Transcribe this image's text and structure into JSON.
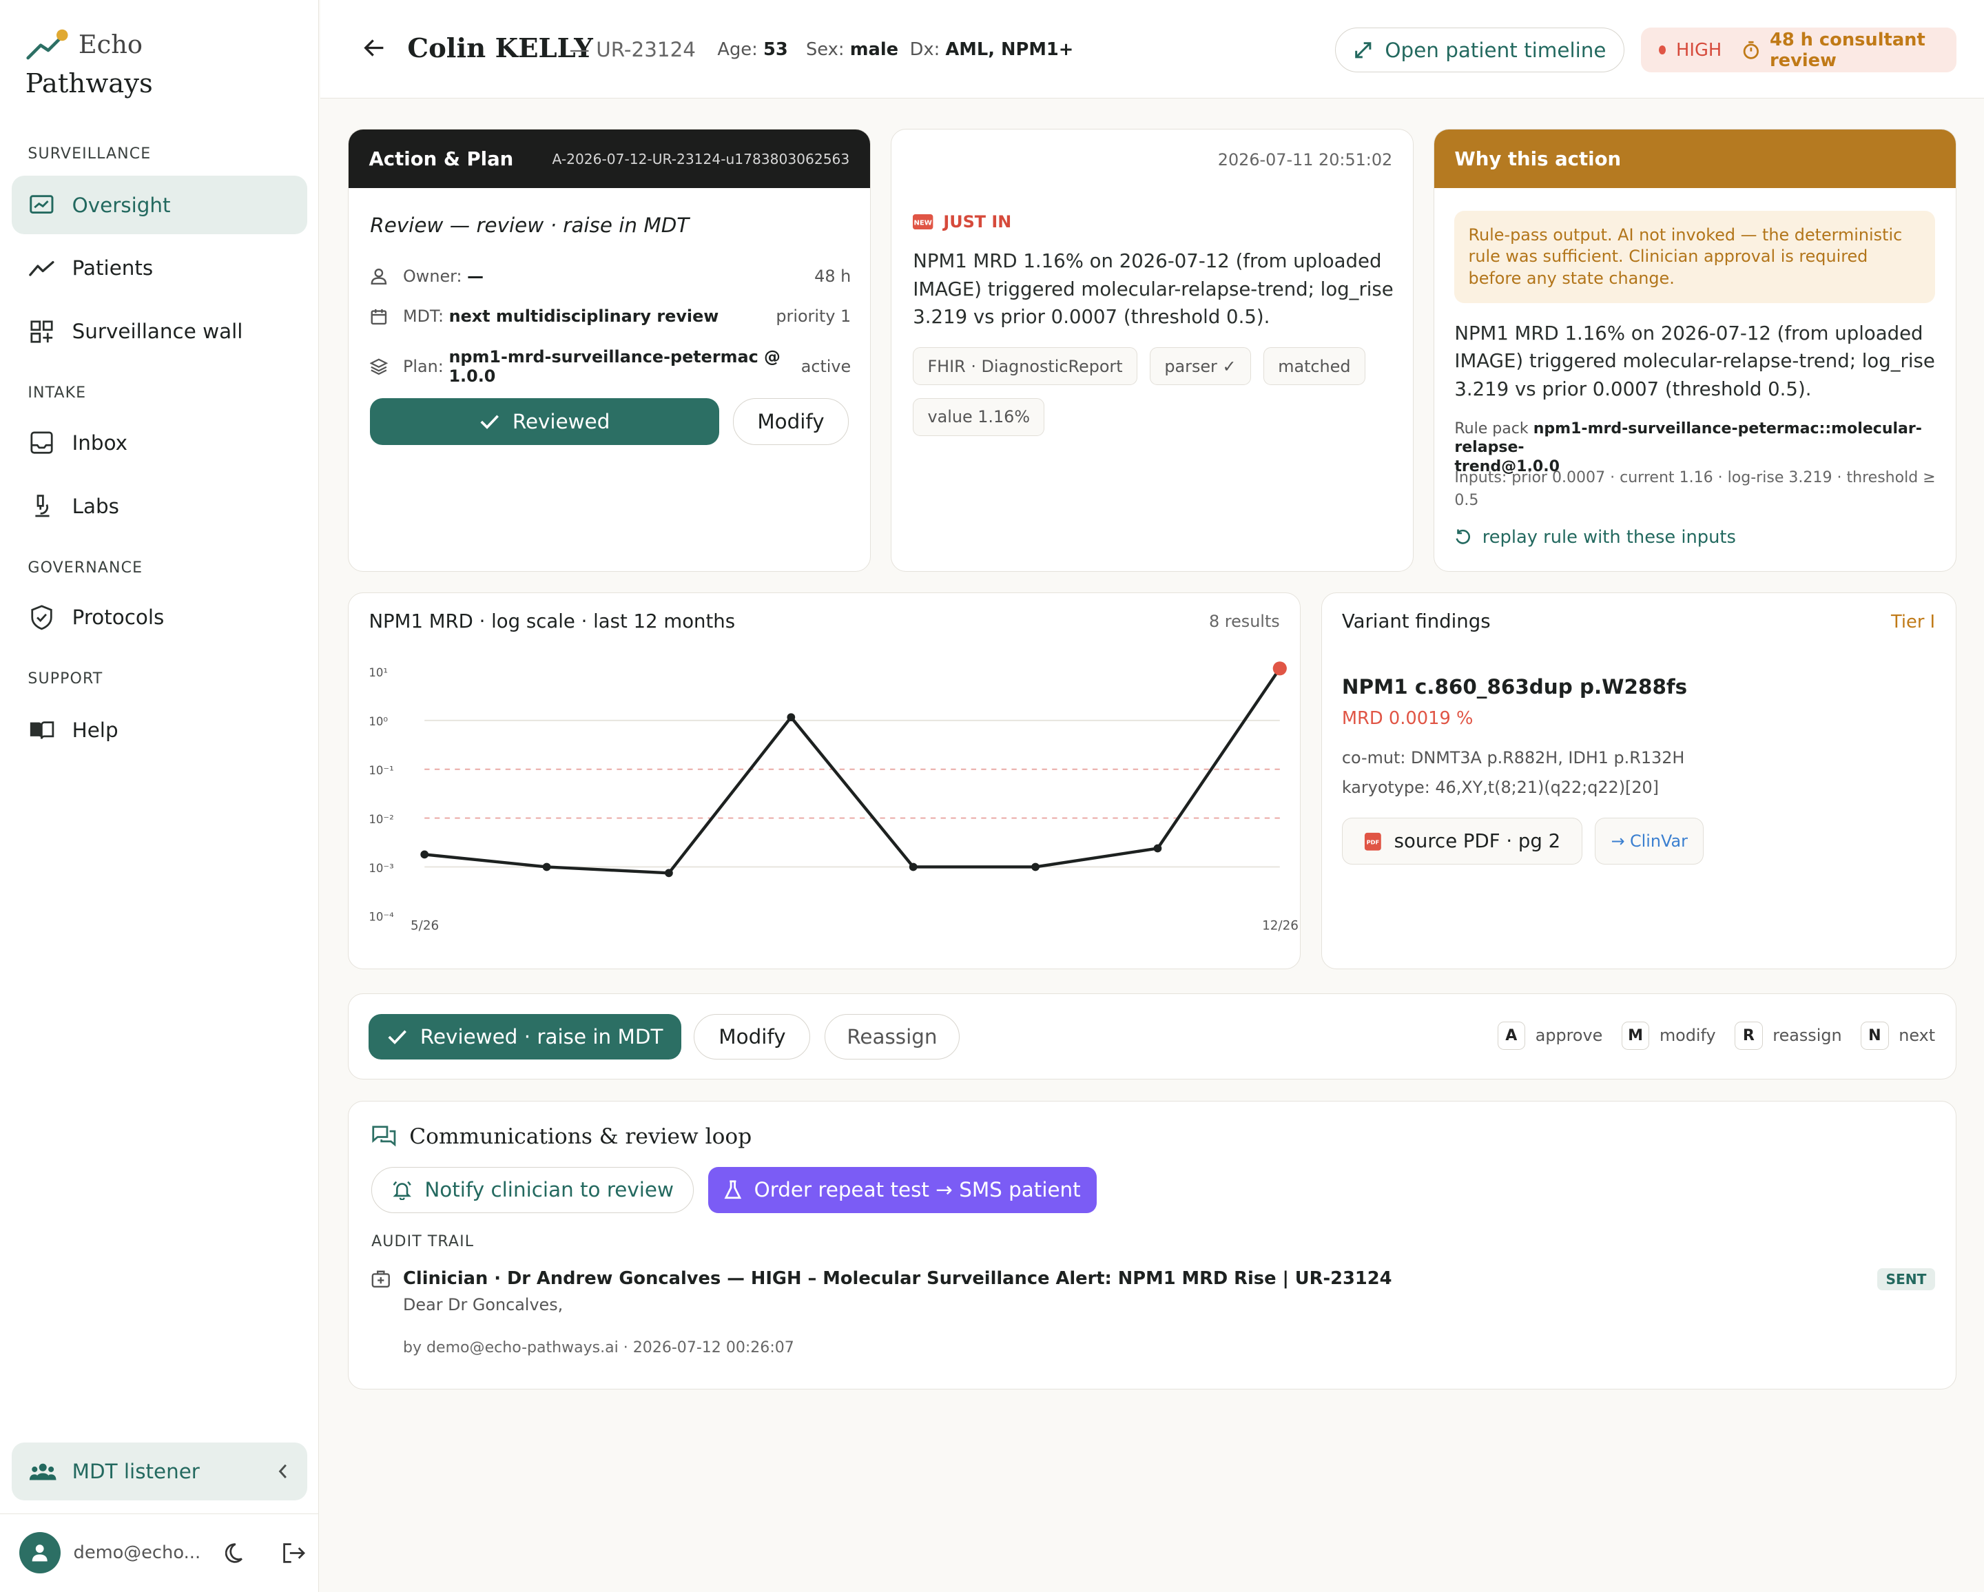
{
  "brand": {
    "name_top": "Echo",
    "name_bottom": "Pathways"
  },
  "sidebar": {
    "sections": [
      {
        "label": "SURVEILLANCE",
        "items": [
          {
            "label": "Oversight",
            "icon": "monitor-chart-icon",
            "active": true
          },
          {
            "label": "Patients",
            "icon": "trend-line-icon"
          },
          {
            "label": "Surveillance wall",
            "icon": "grid-plus-icon"
          }
        ]
      },
      {
        "label": "INTAKE",
        "items": [
          {
            "label": "Inbox",
            "icon": "inbox-icon"
          },
          {
            "label": "Labs",
            "icon": "microscope-icon"
          }
        ]
      },
      {
        "label": "GOVERNANCE",
        "items": [
          {
            "label": "Protocols",
            "icon": "shield-check-icon"
          }
        ]
      },
      {
        "label": "SUPPORT",
        "items": [
          {
            "label": "Help",
            "icon": "book-icon"
          }
        ]
      }
    ],
    "mdt_listener": "MDT listener",
    "user_email": "demo@echo..."
  },
  "header": {
    "name": "Colin KELLY",
    "ur": "— UR-23124",
    "age_label": "Age:",
    "age": "53",
    "sex_label": "Sex:",
    "sex": "male",
    "dx_label": "Dx:",
    "dx": "AML, NPM1+",
    "timeline_button": "Open patient timeline",
    "severity": "HIGH",
    "review_window": "48 h consultant review"
  },
  "action_plan": {
    "title": "Action & Plan",
    "id": "A-2026-07-12-UR-23124-u1783803062563",
    "subtitle": "Review — review · raise in MDT",
    "owner_label": "Owner:",
    "owner": "—",
    "owner_sla": "48 h",
    "mdt_label": "MDT:",
    "mdt": "next multidisciplinary review",
    "priority": "priority 1",
    "plan_label": "Plan:",
    "plan": "npm1-mrd-surveillance-petermac @ 1.0.0",
    "plan_status": "active",
    "reviewed_button": "Reviewed",
    "modify_button": "Modify"
  },
  "event": {
    "timestamp": "2026-07-11 20:51:02",
    "badge": "JUST IN",
    "text": "NPM1 MRD 1.16% on 2026-07-12 (from uploaded IMAGE) triggered molecular-relapse-trend; log_rise 3.219 vs prior 0.0007 (threshold 0.5).",
    "tags": [
      "FHIR · DiagnosticReport",
      "parser ✓",
      "matched",
      "value 1.16%"
    ]
  },
  "why": {
    "title": "Why this action",
    "note": "Rule-pass output. AI not invoked — the deterministic rule was sufficient. Clinician approval is required before any state change.",
    "text": "NPM1 MRD 1.16% on 2026-07-12 (from uploaded IMAGE) triggered molecular-relapse-trend; log_rise 3.219 vs prior 0.0007 (threshold 0.5).",
    "rule_pack_label": "Rule pack",
    "rule_pack_line1": "npm1-mrd-surveillance-petermac::molecular-relapse-",
    "rule_pack_line2": "trend@1.0.0",
    "inputs_line1": "Inputs: prior 0.0007 · current 1.16 · log-rise 3.219 · threshold ≥",
    "inputs_line2": "0.5",
    "replay": "replay rule with these inputs"
  },
  "chart_data": {
    "type": "line",
    "title": "NPM1 MRD · log scale · last 12 months",
    "results_count": "8 results",
    "x": [
      "5/26",
      "",
      "",
      "",
      "",
      "",
      "",
      "12/26"
    ],
    "x_tick_labels": [
      "5/26",
      "12/26"
    ],
    "y_ticks": [
      "10¹",
      "10⁰",
      "10⁻¹",
      "10⁻²",
      "10⁻³",
      "10⁻⁴"
    ],
    "y_tick_exponents": [
      1,
      0,
      -1,
      -2,
      -3,
      -4
    ],
    "ylim": [
      0.0001,
      10
    ],
    "log_scale": true,
    "series": [
      {
        "values": [
          0.0018,
          0.001,
          0.00075,
          1.16,
          0.001,
          0.001,
          0.0024,
          11.6
        ]
      }
    ],
    "threshold_lines": [
      0.1,
      0.01
    ],
    "last_point_highlight": true,
    "colors": {
      "line": "#1d2120",
      "last_point": "#e05545",
      "threshold": "#e8a4a0",
      "grid": "#e6e3dc"
    }
  },
  "variant": {
    "title": "Variant findings",
    "tier": "Tier I",
    "name": "NPM1 c.860_863dup p.W288fs",
    "mrd": "MRD 0.0019 %",
    "comut": "co-mut: DNMT3A p.R882H, IDH1 p.R132H",
    "karyotype": "karyotype: 46,XY,t(8;21)(q22;q22)[20]",
    "source_button": "source PDF · pg 2",
    "clinvar_button": "→ ClinVar"
  },
  "action_bar": {
    "primary": "Reviewed · raise in MDT",
    "modify": "Modify",
    "reassign": "Reassign",
    "shortcuts": [
      {
        "key": "A",
        "label": "approve"
      },
      {
        "key": "M",
        "label": "modify"
      },
      {
        "key": "R",
        "label": "reassign"
      },
      {
        "key": "N",
        "label": "next"
      }
    ]
  },
  "comms": {
    "title": "Communications & review loop",
    "notify_button": "Notify clinician to review",
    "order_button": "Order repeat test → SMS patient",
    "audit_label": "AUDIT TRAIL",
    "entry_title": "Clinician · Dr Andrew Goncalves — HIGH – Molecular Surveillance Alert: NPM1 MRD Rise | UR-23124",
    "entry_status": "SENT",
    "entry_body": "Dear Dr Goncalves,",
    "entry_meta": "by demo@echo-pathways.ai · 2026-07-12 00:26:07"
  },
  "colors": {
    "accent": "#2c6f64",
    "why_header": "#b57a21",
    "order_button": "#7b5cf5",
    "high": "#d64a3b"
  }
}
